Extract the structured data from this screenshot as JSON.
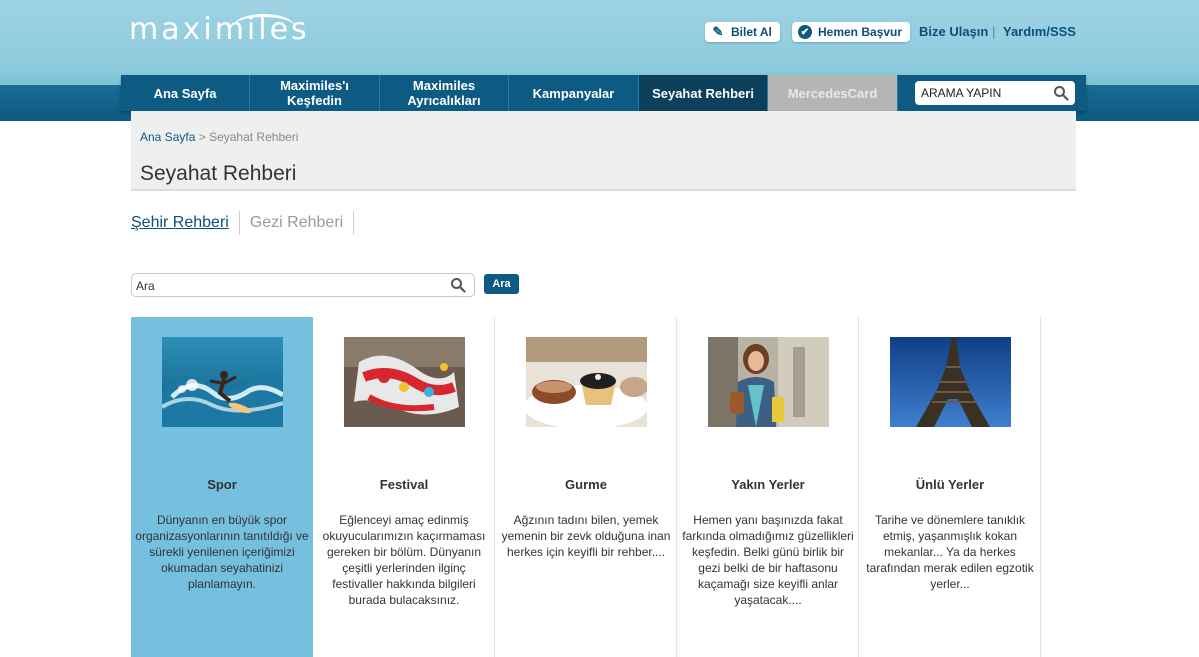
{
  "header": {
    "logo_text": "maximiles",
    "buttons": {
      "bilet_al": "Bilet Al",
      "hemen_basvur": "Hemen Başvur"
    },
    "links": {
      "bize_ulasin": "Bize Ulaşın",
      "separator": "|",
      "yardim": "Yardım/SSS"
    }
  },
  "nav": {
    "items": [
      {
        "label": "Ana Sayfa"
      },
      {
        "label": "Maximiles'ı\nKeşfedin"
      },
      {
        "label": "Maximiles\nAyrıcalıkları"
      },
      {
        "label": "Kampanyalar"
      },
      {
        "label": "Seyahat Rehberi"
      },
      {
        "label": "MercedesCard"
      }
    ],
    "search_value": "ARAMA YAPIN"
  },
  "breadcrumb": {
    "home": "Ana Sayfa",
    "separator": " > ",
    "current": "Seyahat Rehberi"
  },
  "page_title": "Seyahat Rehberi",
  "tabs": {
    "sehir": "Şehir Rehberi",
    "gezi": "Gezi Rehberi"
  },
  "search": {
    "value": "Ara",
    "button": "Ara"
  },
  "cards": [
    {
      "title": "Spor",
      "desc": "Dünyanın en büyük spor organizasyonlarının tanıtıldığı ve sürekli yenilenen içeriğimizi okumadan seyahatinizi planlamayın."
    },
    {
      "title": "Festival",
      "desc": "Eğlenceyi amaç edinmiş okuyucularımızın kaçırmaması gereken bir bölüm. Dünyanın çeşitli yerlerinden ilginç festivaller hakkında bilgileri burada bulacaksınız."
    },
    {
      "title": "Gurme",
      "desc": "Ağzının tadını bilen, yemek yemenin bir zevk olduğuna inan herkes için keyifli bir rehber...."
    },
    {
      "title": "Yakın Yerler",
      "desc": "Hemen yanı başınızda fakat farkında olmadığımız güzellikleri keşfedin. Belki günü birlik bir gezi belki de bir haftasonu kaçamağı size keyifli anlar yaşatacak...."
    },
    {
      "title": "Ünlü Yerler",
      "desc": "Tarihe ve dönemlere tanıklık etmiş, yaşanmışlık kokan mekanlar... Ya da herkes tarafından merak edilen egzotik yerler..."
    }
  ],
  "colors": {
    "brand_dark": "#0d5a82",
    "selected_card": "#75bfdf",
    "header_bg": "#8ccbdd"
  }
}
